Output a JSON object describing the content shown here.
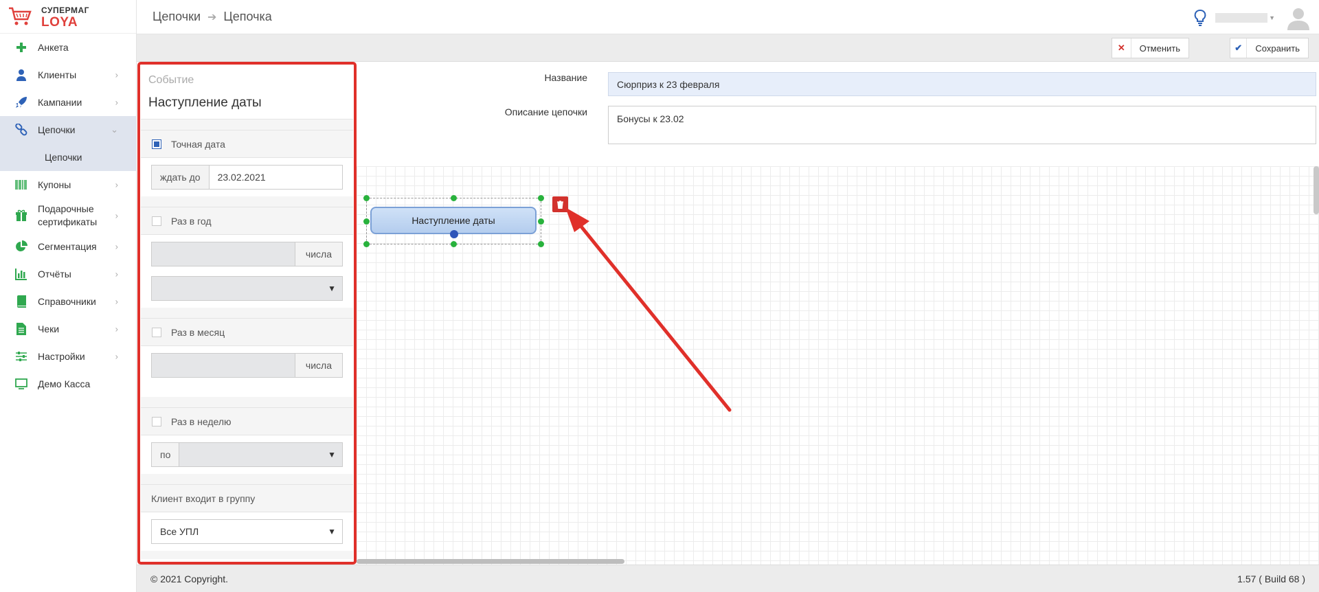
{
  "brand": {
    "line1": "СУПЕРМАГ",
    "line2": "LOYA",
    "accent": "#e0413c"
  },
  "sidebar": {
    "items": [
      {
        "label": "Анкета",
        "icon": "plus-icon",
        "color": "#2fa84f"
      },
      {
        "label": "Клиенты",
        "icon": "user-icon",
        "color": "#2e62b7"
      },
      {
        "label": "Кампании",
        "icon": "rocket-icon",
        "color": "#2e62b7"
      },
      {
        "label": "Цепочки",
        "icon": "link-icon",
        "color": "#2e62b7"
      },
      {
        "label": "Цепочки",
        "icon": "none"
      },
      {
        "label": "Купоны",
        "icon": "barcode-icon",
        "color": "#2fa84f"
      },
      {
        "label": "Подарочные сертификаты",
        "icon": "gift-icon",
        "color": "#2fa84f"
      },
      {
        "label": "Сегментация",
        "icon": "pie-chart-icon",
        "color": "#2fa84f"
      },
      {
        "label": "Отчёты",
        "icon": "bar-chart-icon",
        "color": "#2fa84f"
      },
      {
        "label": "Справочники",
        "icon": "book-icon",
        "color": "#2fa84f"
      },
      {
        "label": "Чеки",
        "icon": "document-icon",
        "color": "#2fa84f"
      },
      {
        "label": "Настройки",
        "icon": "sliders-icon",
        "color": "#2fa84f"
      },
      {
        "label": "Демо Касса",
        "icon": "monitor-icon",
        "color": "#2fa84f"
      }
    ]
  },
  "header": {
    "crumb1": "Цепочки",
    "crumb2": "Цепочка"
  },
  "toolbar": {
    "cancel_label": "Отменить",
    "save_label": "Сохранить"
  },
  "panel": {
    "kind": "Событие",
    "title": "Наступление даты",
    "exact_date": {
      "label": "Точная дата",
      "checked": true,
      "wait_label": "ждать до",
      "date_value": "23.02.2021"
    },
    "yearly": {
      "label": "Раз в год",
      "checked": false,
      "unit": "числа"
    },
    "monthly": {
      "label": "Раз в месяц",
      "checked": false,
      "unit": "числа"
    },
    "weekly": {
      "label": "Раз в неделю",
      "checked": false,
      "prefix": "по"
    },
    "group": {
      "label": "Клиент входит в группу",
      "value": "Все УПЛ"
    }
  },
  "form": {
    "name_label": "Название",
    "name_value": "Сюрприз к 23 февраля",
    "desc_label": "Описание цепочки",
    "desc_value": "Бонусы к 23.02"
  },
  "canvas": {
    "node_label": "Наступление даты"
  },
  "footer": {
    "copyright": "© 2021 Copyright.",
    "version": "1.57 ( Build 68 )"
  }
}
